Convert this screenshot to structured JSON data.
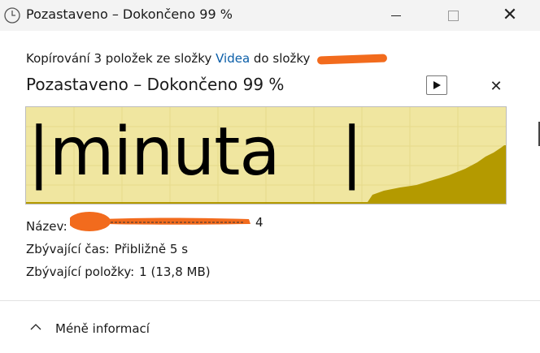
{
  "window": {
    "title": "Pozastaveno – Dokončeno 99 %"
  },
  "copy": {
    "prefix": "Kopírování 3 položek ze složky ",
    "source_folder": "Videa",
    "middle": " do složky "
  },
  "status": {
    "title": "Pozastaveno – Dokončeno 99 %",
    "percent_complete": 99
  },
  "graph": {
    "speed_text": "|minuta   |",
    "fill_color": "#b49a00",
    "background_color": "#f0e6a0"
  },
  "details": {
    "name_label": "Název:",
    "name_suffix": "4",
    "time_label": "Zbývající čas:",
    "time_value": "Přibližně 5 s",
    "items_label": "Zbývající položky:",
    "items_value": "1 (13,8 MB)"
  },
  "footer": {
    "toggle_label": "Méně informací"
  },
  "colors": {
    "link": "#0a5ea8",
    "redaction": "#f26b1d"
  }
}
